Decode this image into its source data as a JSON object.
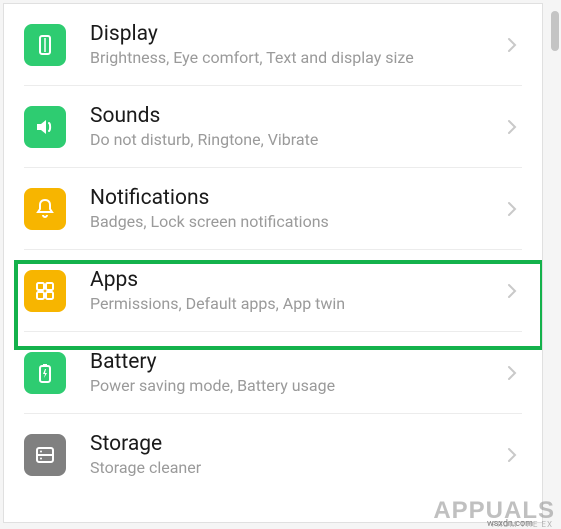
{
  "settings": {
    "items": [
      {
        "title": "Display",
        "subtitle": "Brightness, Eye comfort, Text and display size",
        "icon": "display-icon",
        "color": "green"
      },
      {
        "title": "Sounds",
        "subtitle": "Do not disturb, Ringtone, Vibrate",
        "icon": "sounds-icon",
        "color": "green"
      },
      {
        "title": "Notifications",
        "subtitle": "Badges, Lock screen notifications",
        "icon": "notifications-icon",
        "color": "yellow"
      },
      {
        "title": "Apps",
        "subtitle": "Permissions, Default apps, App twin",
        "icon": "apps-icon",
        "color": "yellow",
        "highlighted": true
      },
      {
        "title": "Battery",
        "subtitle": "Power saving mode, Battery usage",
        "icon": "battery-icon",
        "color": "green"
      },
      {
        "title": "Storage",
        "subtitle": "Storage cleaner",
        "icon": "storage-icon",
        "color": "grey"
      }
    ]
  },
  "watermark": {
    "main": "APPUALS",
    "sub": "FROM THE EX",
    "attribution": "wsxdn.com"
  },
  "colors": {
    "highlight": "#14b24c",
    "green": "#2ecc71",
    "yellow": "#f7b500",
    "grey": "#808080"
  }
}
